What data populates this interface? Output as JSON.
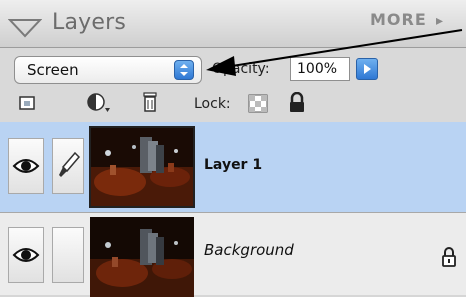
{
  "panel": {
    "title": "Layers",
    "more_label": "MORE",
    "more_arrow": "▸"
  },
  "options": {
    "blend_mode": "Screen",
    "opacity_label": "Opacity:",
    "opacity_value": "100%",
    "lock_label": "Lock:"
  },
  "layers": [
    {
      "name": "Layer 1",
      "selected": true,
      "visible": true,
      "linked_icon": "brush-icon"
    },
    {
      "name": "Background",
      "selected": false,
      "visible": true,
      "locked": true
    }
  ],
  "colors": {
    "selection": "#b9d3f3",
    "accent_blue": "#2f78d4"
  }
}
